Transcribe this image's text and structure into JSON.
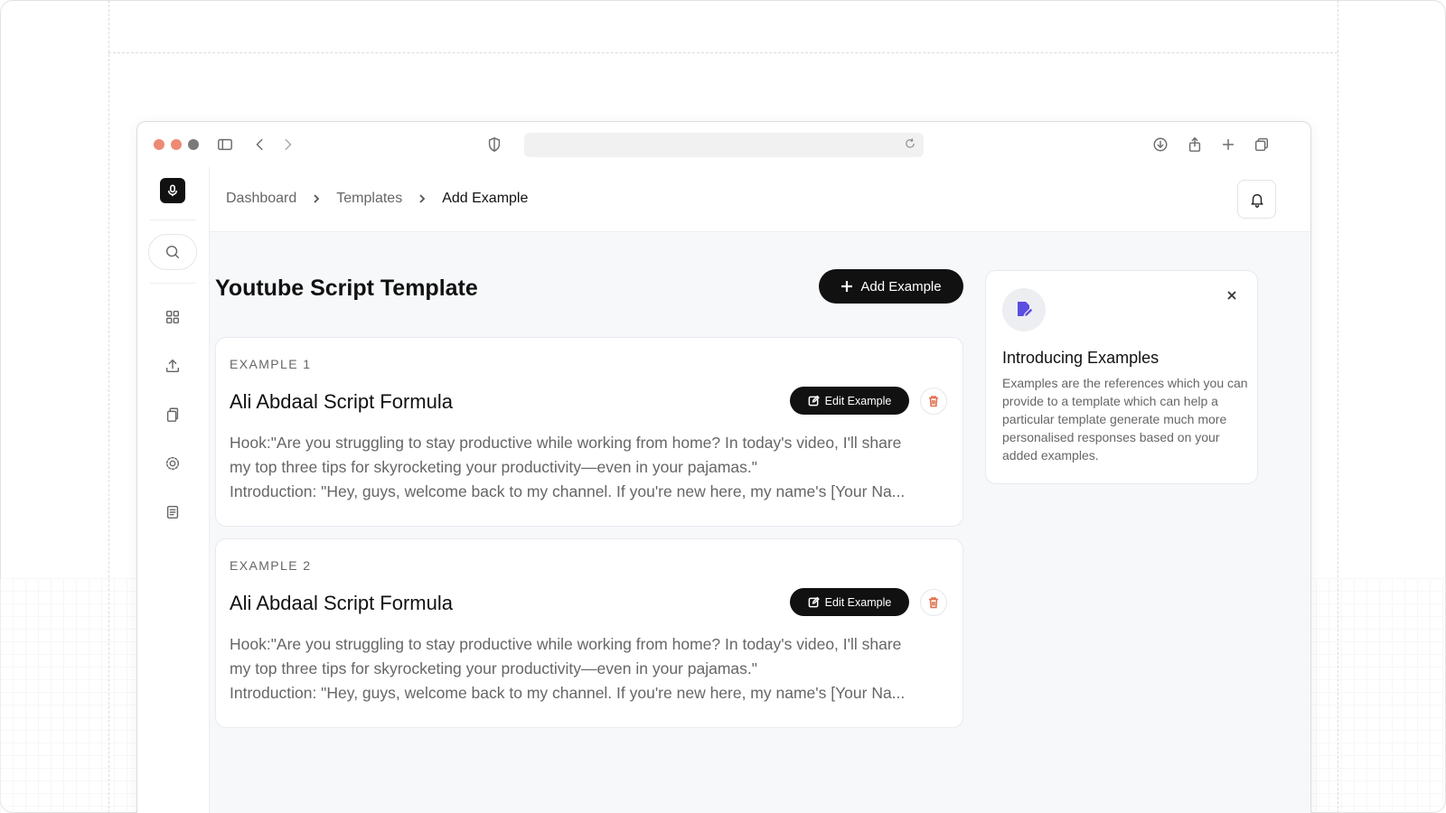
{
  "breadcrumb": {
    "items": [
      "Dashboard",
      "Templates",
      "Add Example"
    ]
  },
  "page": {
    "title": "Youtube Script Template",
    "add_button_label": "Add Example"
  },
  "examples": [
    {
      "eyebrow": "EXAMPLE 1",
      "title": "Ali Abdaal Script Formula",
      "edit_label": "Edit Example",
      "lines": [
        "Hook:\"Are you struggling to stay productive while working from home? In today's video, I'll share",
        "my top three tips for skyrocketing your productivity—even in your pajamas.\"",
        "Introduction: \"Hey, guys, welcome back to my channel. If you're new here, my name's [Your Na..."
      ]
    },
    {
      "eyebrow": "EXAMPLE 2",
      "title": "Ali Abdaal Script Formula",
      "edit_label": "Edit Example",
      "lines": [
        "Hook:\"Are you struggling to stay productive while working from home? In today's video, I'll share",
        "my top three tips for skyrocketing your productivity—even in your pajamas.\"",
        "Introduction: \"Hey, guys, welcome back to my channel. If you're new here, my name's [Your Na..."
      ]
    }
  ],
  "info_card": {
    "title": "Introducing Examples",
    "text": "Examples are the references which you can provide to a template which can help a particular template generate much more personalised responses based on your added examples."
  },
  "icons": {
    "logo": "microphone-icon",
    "sidebar": [
      "search-icon",
      "grid-icon",
      "upload-icon",
      "copy-icon",
      "settings-icon",
      "document-list-icon"
    ],
    "topbar": "bell-icon",
    "info": "edit-document-icon"
  },
  "colors": {
    "primary": "#111111",
    "accent": "#5b4de0",
    "danger": "#e0714f",
    "background": "#f7f8fa"
  }
}
